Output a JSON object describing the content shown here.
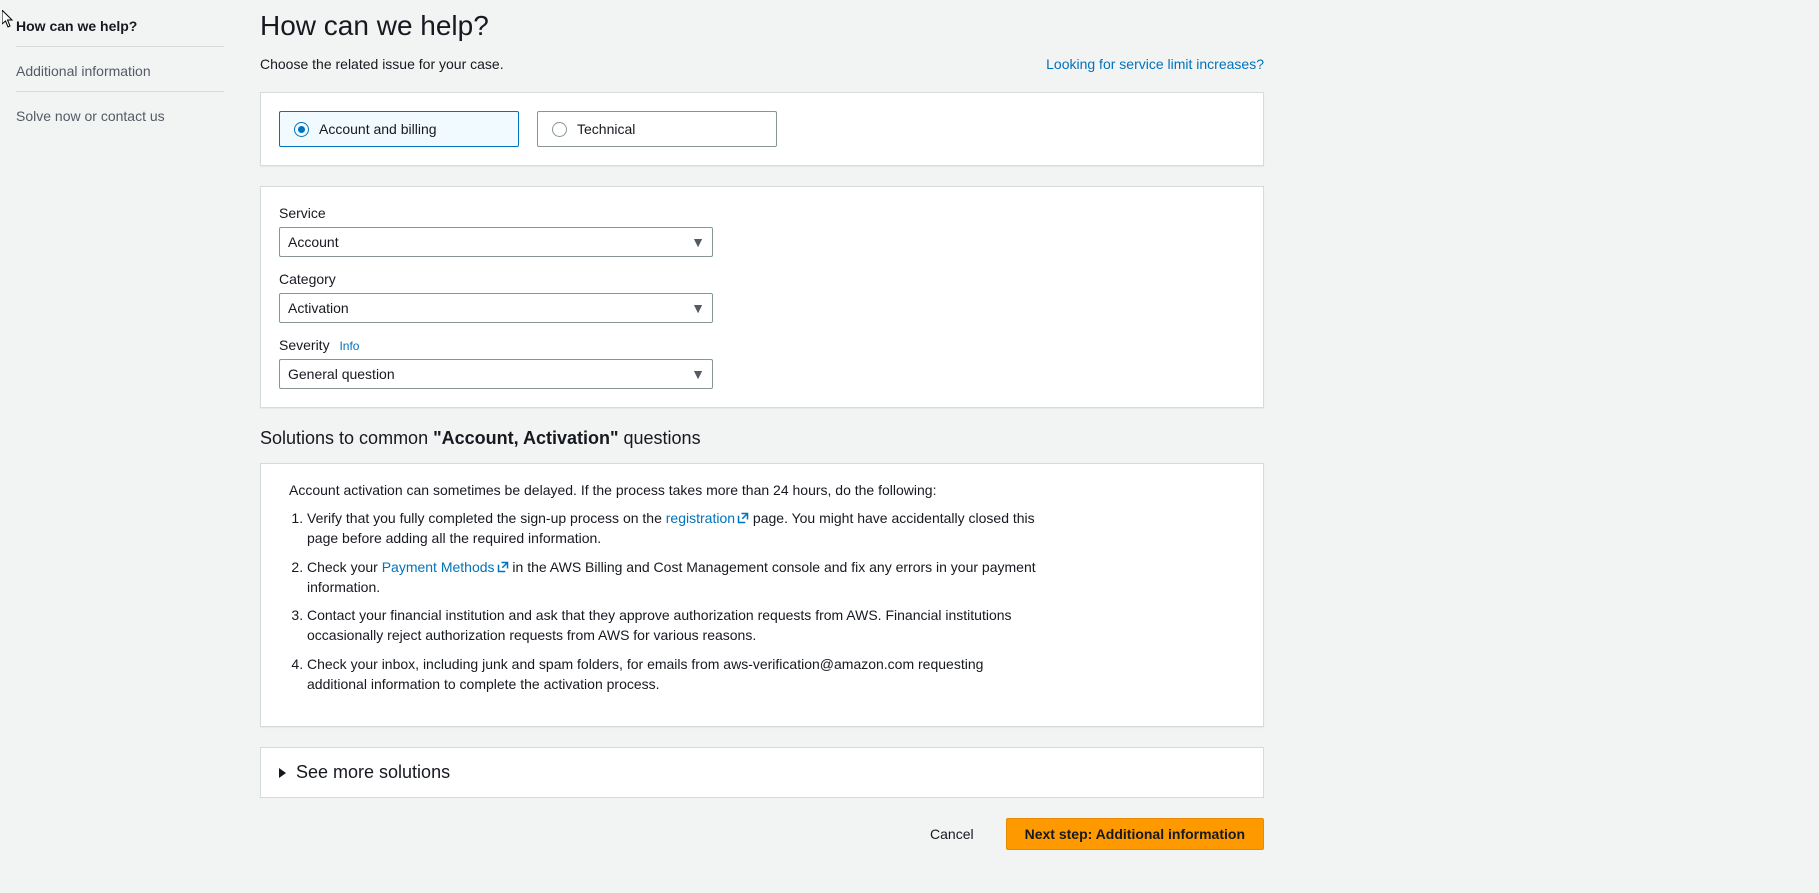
{
  "sidebar": {
    "items": [
      {
        "label": "How can we help?",
        "active": true
      },
      {
        "label": "Additional information",
        "active": false
      },
      {
        "label": "Solve now or contact us",
        "active": false
      }
    ]
  },
  "header": {
    "title": "How can we help?",
    "subtitle": "Choose the related issue for your case.",
    "link_text": "Looking for service limit increases?"
  },
  "issue_type": {
    "options": [
      {
        "label": "Account and billing",
        "selected": true
      },
      {
        "label": "Technical",
        "selected": false
      }
    ]
  },
  "form": {
    "service_label": "Service",
    "service_value": "Account",
    "category_label": "Category",
    "category_value": "Activation",
    "severity_label": "Severity",
    "severity_info": "Info",
    "severity_value": "General question"
  },
  "solutions": {
    "heading_prefix": "Solutions to common ",
    "heading_strong": "\"Account, Activation\"",
    "heading_suffix": " questions",
    "intro": "Account activation can sometimes be delayed. If the process takes more than 24 hours, do the following:",
    "items": {
      "i1_a": "Verify that you fully completed the sign-up process on the ",
      "i1_link": "registration",
      "i1_b": " page. You might have accidentally closed this page before adding all the required information.",
      "i2_a": "Check your ",
      "i2_link": "Payment Methods",
      "i2_b": " in the AWS Billing and Cost Management console and fix any errors in your payment information.",
      "i3": "Contact your financial institution and ask that they approve authorization requests from AWS. Financial institutions occasionally reject authorization requests from AWS for various reasons.",
      "i4": "Check your inbox, including junk and spam folders, for emails from aws-verification@amazon.com requesting additional information to complete the activation process."
    },
    "see_more": "See more solutions"
  },
  "footer": {
    "cancel": "Cancel",
    "next": "Next step: Additional information"
  }
}
